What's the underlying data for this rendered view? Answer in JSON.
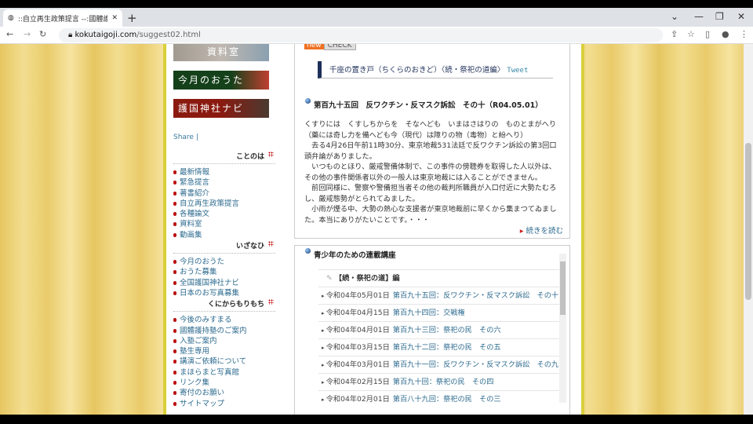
{
  "browser": {
    "tab_title": "::自立再生政策提言 --:國體護持",
    "url_domain": "kokutaigoji.com",
    "url_path": "/suggest02.html"
  },
  "sidebar": {
    "banners": [
      "資料室",
      "今月のおうた",
      "護国神社ナビ"
    ],
    "share": "Share |",
    "sections": [
      {
        "title": "ことのは",
        "items": [
          "最新情報",
          "緊急提言",
          "著書紹介",
          "自立再生政策提言",
          "各種論文",
          "資料室",
          "動画集"
        ]
      },
      {
        "title": "いざなひ",
        "items": [
          "今月のおうた",
          "おうた募集",
          "全国護国神社ナビ",
          "日本のお写真募集"
        ]
      },
      {
        "title": "くにからもりもち",
        "items": [
          "今後のみすまる",
          "國體護持塾のご案内",
          "入塾ご案内",
          "塾生専用",
          "講演ご依頼について",
          "まほらまと写真館",
          "リンク集",
          "寄付のお願い",
          "サイトマップ"
        ]
      }
    ]
  },
  "main": {
    "badge_new": "new",
    "badge_check": "CHECK",
    "section_title": "千座の置き戸（ちくらのおきど）〈続・祭祀の道編〉",
    "tweet": "Tweet",
    "article_title": "第百九十五回　反ワクチン・反マスク訴訟　その十（R04.05.01）",
    "article_lines": [
      "くすりには　くすしちからを　そなへども　いまはさはりの　ものとまがへり",
      "（藥には奇し力を備へども今（現代）は障りの物（毒物）と紛へり）",
      "　去る4月26日午前11時30分、東京地裁531法廷で反ワクチン訴訟の第3回口頭弁論がありました。",
      "　いつものとほり、厳戒警備体制で、この事件の傍聴券を取得した人以外は、その他の事件関係者以外の一般人は東京地裁には入ることができません。",
      "　前回同様に、警察や警備担当者その他の裁判所職員が入口付近に大勢たむろし、厳戒態勢がとられてゐました。",
      "　小雨が煙る中、大勢の熱心な支援者が東京地裁前に早くから集まつてゐました。本当にありがたいことです。・・・"
    ],
    "read_more": "続きを読む",
    "series_title": "青少年のための連載講座",
    "series_sub": "【続・祭祀の道】編",
    "entries": [
      {
        "date": "令和04年05月01日",
        "title": "第百九十五回：反ワクチン・反マスク訴訟　その十"
      },
      {
        "date": "令和04年04月15日",
        "title": "第百九十四回：交戦権"
      },
      {
        "date": "令和04年04月01日",
        "title": "第百九十三回：祭祀の民　その六"
      },
      {
        "date": "令和04年03月15日",
        "title": "第百九十二回：祭祀の民　その五"
      },
      {
        "date": "令和04年03月01日",
        "title": "第百九十一回：反ワクチン・反マスク訴訟　その九"
      },
      {
        "date": "令和04年02月15日",
        "title": "第百九十回：祭祀の民　その四"
      },
      {
        "date": "令和04年02月01日",
        "title": "第百八十九回：祭祀の民　その三"
      }
    ]
  }
}
